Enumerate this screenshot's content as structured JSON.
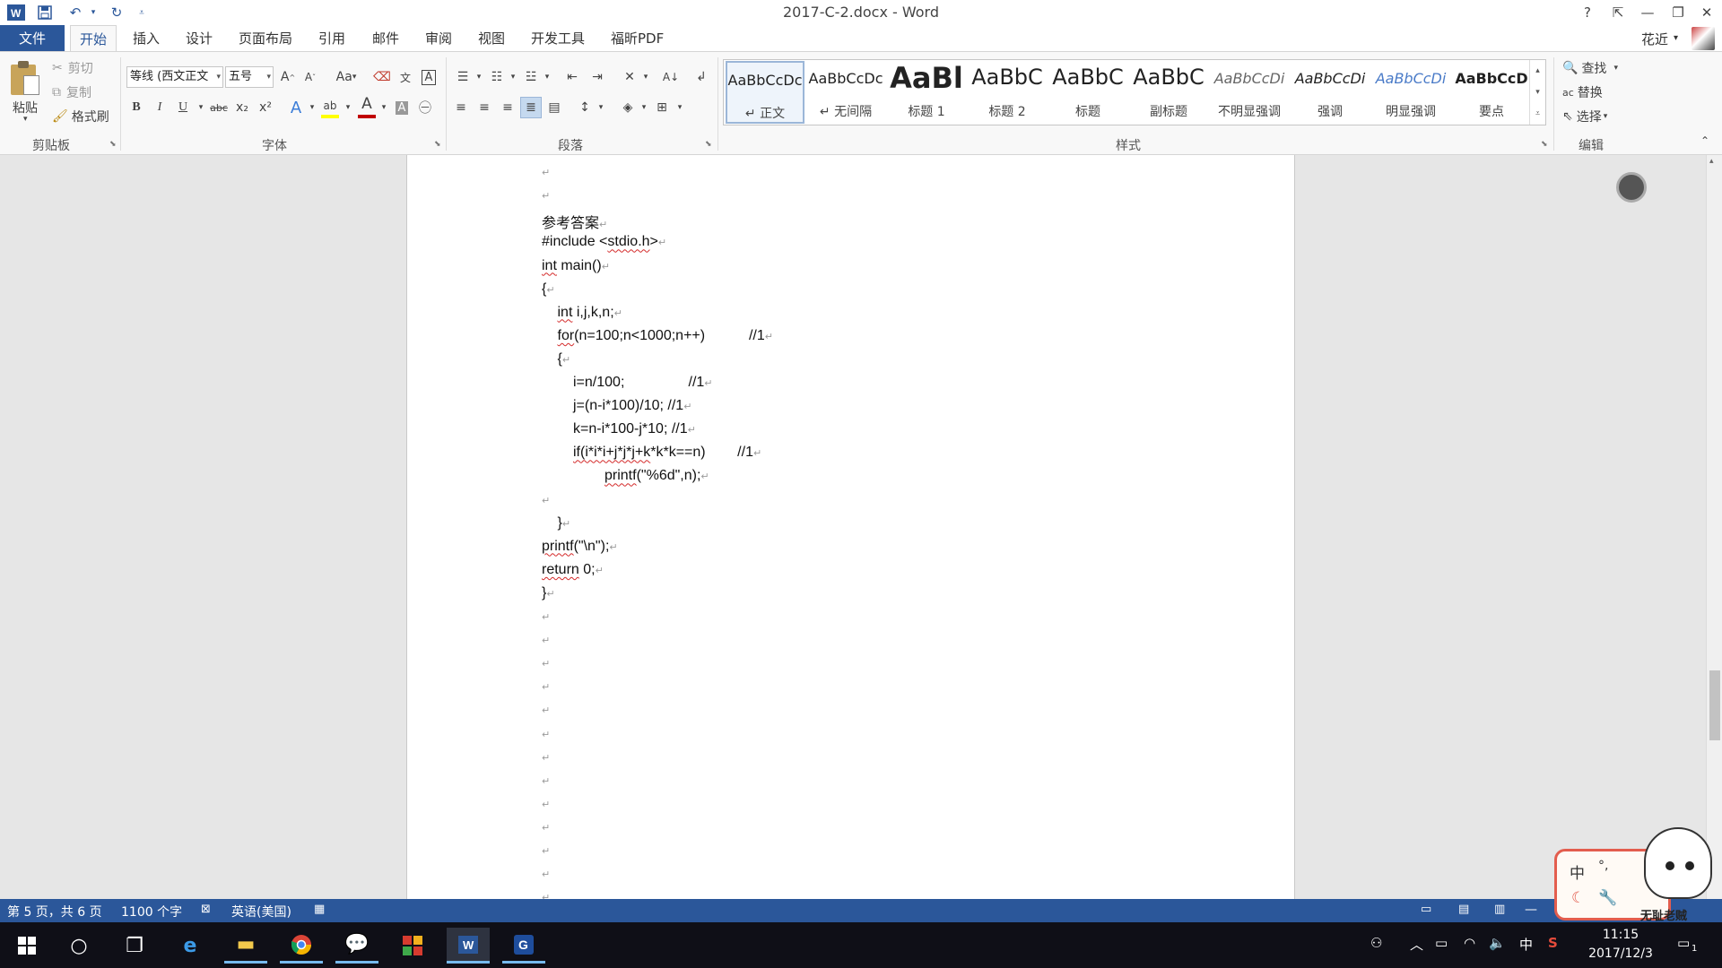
{
  "window": {
    "title": "2017-C-2.docx - Word",
    "help": "?",
    "ribbon_display": "⇱",
    "minimize": "—",
    "restore": "❐",
    "close": "✕"
  },
  "quick_access": {
    "app_icon": "word-logo",
    "save": "save-icon",
    "undo": "undo-icon",
    "redo": "redo-icon",
    "customize": "customize-icon"
  },
  "ribbon_tabs": [
    "文件",
    "开始",
    "插入",
    "设计",
    "页面布局",
    "引用",
    "邮件",
    "审阅",
    "视图",
    "开发工具",
    "福昕PDF"
  ],
  "user": {
    "name": "花近",
    "dropdown": "▾"
  },
  "clipboard": {
    "label": "剪贴板",
    "paste": "粘贴",
    "cut": "剪切",
    "copy": "复制",
    "format_painter": "格式刷"
  },
  "font": {
    "label": "字体",
    "name": "等线 (西文正文",
    "size": "五号",
    "grow": "A",
    "shrink": "A",
    "case": "Aa",
    "bold": "B",
    "italic": "I",
    "underline": "U",
    "strike": "abc",
    "subscript": "x₂",
    "superscript": "x²",
    "font_color": "A",
    "highlight_color": "#ffff00",
    "text_color": "#c00000"
  },
  "paragraph": {
    "label": "段落"
  },
  "styles": {
    "label": "样式",
    "items": [
      {
        "sample": "AaBbCcDc",
        "name": "正文"
      },
      {
        "sample": "AaBbCcDc",
        "name": "无间隔"
      },
      {
        "sample": "AaBl",
        "name": "标题 1"
      },
      {
        "sample": "AaBbC",
        "name": "标题 2"
      },
      {
        "sample": "AaBbC",
        "name": "标题"
      },
      {
        "sample": "AaBbC",
        "name": "副标题"
      },
      {
        "sample": "AaBbCcDi",
        "name": "不明显强调"
      },
      {
        "sample": "AaBbCcDi",
        "name": "强调"
      },
      {
        "sample": "AaBbCcDi",
        "name": "明显强调"
      },
      {
        "sample": "AaBbCcD",
        "name": "要点"
      }
    ]
  },
  "editing": {
    "label": "编辑",
    "find": "查找",
    "replace": "替换",
    "select": "选择"
  },
  "document": {
    "pilcrow": "↵",
    "lines": [
      {
        "indent": 0,
        "text": "参考答案",
        "kind": "heading"
      },
      {
        "indent": 0,
        "text": "#include <stdio.h>"
      },
      {
        "indent": 0,
        "text": "int main()"
      },
      {
        "indent": 0,
        "text": "{"
      },
      {
        "indent": 1,
        "text": "int i,j,k,n;"
      },
      {
        "indent": 1,
        "text": "for(n=100;n<1000;n++)           //1"
      },
      {
        "indent": 1,
        "text": "{"
      },
      {
        "indent": 2,
        "text": "i=n/100;                //1"
      },
      {
        "indent": 2,
        "text": "j=(n-i*100)/10; //1"
      },
      {
        "indent": 2,
        "text": "k=n-i*100-j*10; //1"
      },
      {
        "indent": 2,
        "text": "if(i*i*i+j*j*j+k*k*k==n)        //1"
      },
      {
        "indent": 4,
        "text": "printf(\"%6d\",n);"
      },
      {
        "indent": 0,
        "text": ""
      },
      {
        "indent": 1,
        "text": "}"
      },
      {
        "indent": 0,
        "text": "printf(\"\\n\");"
      },
      {
        "indent": 0,
        "text": "return 0;"
      },
      {
        "indent": 0,
        "text": "}"
      }
    ]
  },
  "status": {
    "page": "第 5 页，共 6 页",
    "words": "1100 个字",
    "language": "英语(美国)",
    "zoom_minus": "—"
  },
  "ime": {
    "mode": "中",
    "punct": "°,",
    "name": "无耻老贼"
  },
  "taskbar": {
    "time": "11:15",
    "date": "2017/12/3",
    "input_lang": "中",
    "notification_count": "1"
  },
  "colors": {
    "word_blue": "#2b579a",
    "taskbar": "#0f0f17",
    "squiggle_red": "#d42a2a",
    "squiggle_blue": "#2b5fd4"
  }
}
